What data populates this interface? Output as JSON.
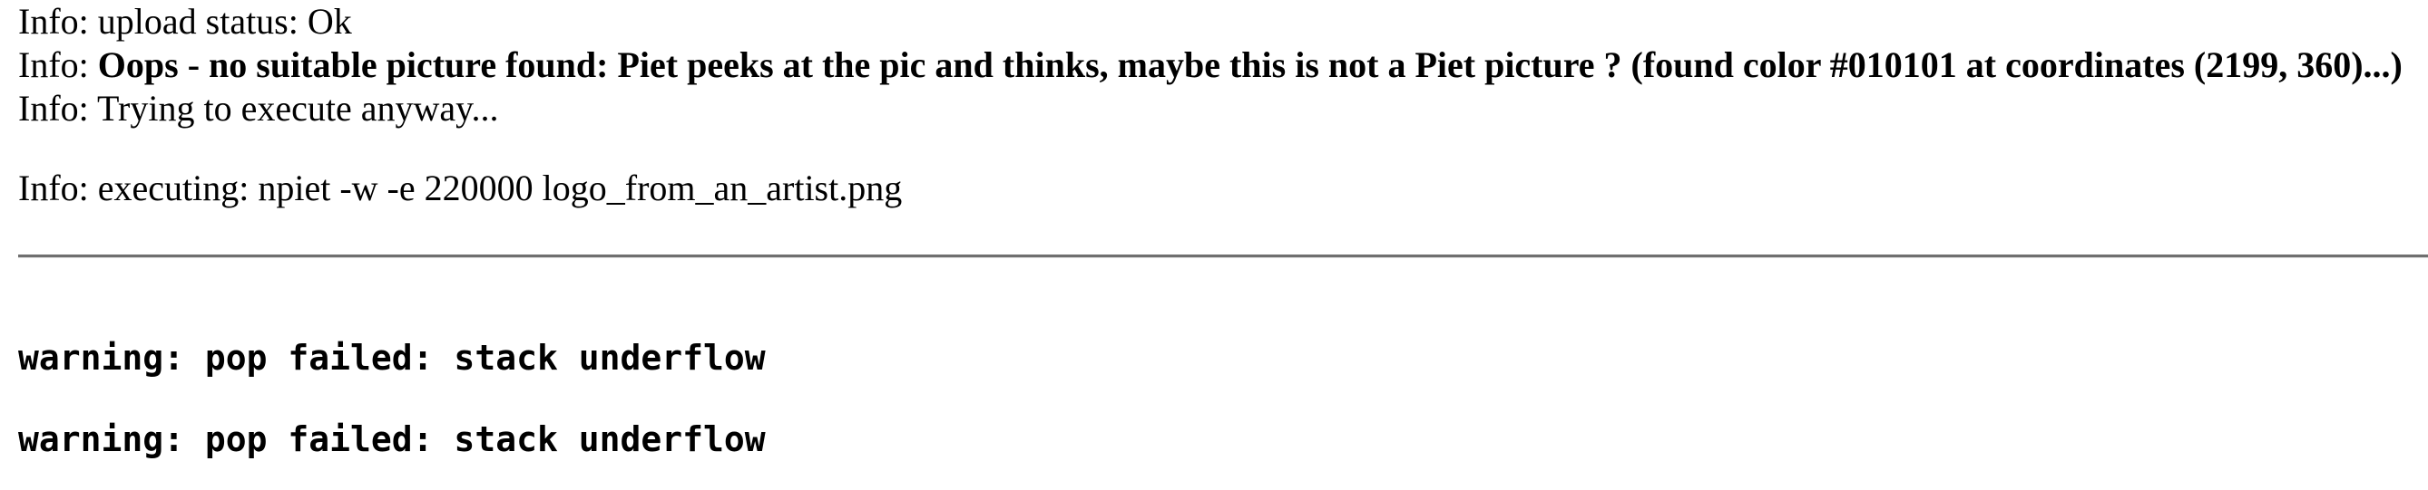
{
  "log": {
    "lines": [
      {
        "prefix": "Info: ",
        "text": "upload status: Ok"
      },
      {
        "prefix": "Info: ",
        "text": "Oops - no suitable picture found: Piet peeks at the pic and thinks, maybe this is not a Piet picture ? (found color #010101 at coordinates (2199, 360)...)"
      },
      {
        "prefix": "Info: ",
        "text": "Trying to execute anyway..."
      },
      {
        "prefix": "Info: ",
        "text": "executing: npiet -w -e 220000 logo_from_an_artist.png"
      }
    ]
  },
  "output": {
    "warnings": [
      "warning: pop failed: stack underflow",
      "warning: pop failed: stack underflow"
    ]
  }
}
